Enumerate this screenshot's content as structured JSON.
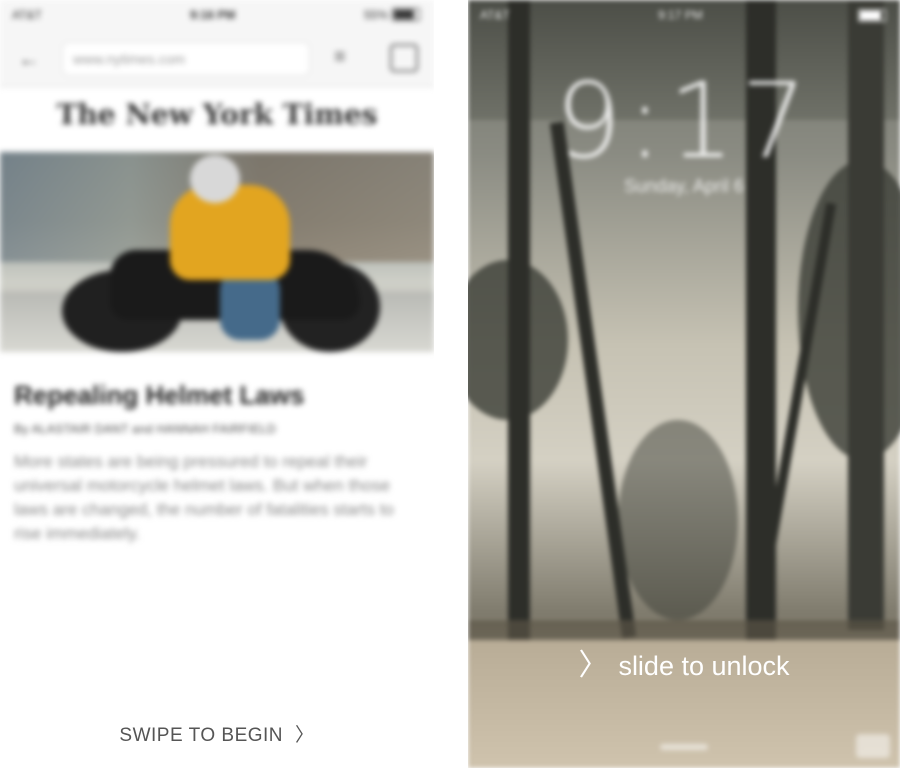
{
  "left_phone": {
    "status": {
      "carrier": "AT&T",
      "time": "9:16 PM",
      "battery": "55%"
    },
    "browser": {
      "url": "www.nytimes.com"
    },
    "masthead": "The New York Times",
    "article": {
      "headline": "Repealing Helmet Laws",
      "byline": "By ALASTAIR DANT and HANNAH FAIRFIELD",
      "summary": "More states are being pressured to repeal their universal motorcycle helmet laws. But when those laws are changed, the number of fatalities starts to rise immediately."
    },
    "swipe_label": "SWIPE TO BEGIN",
    "swipe_icon": "chevron-right-icon"
  },
  "right_phone": {
    "status": {
      "carrier": "AT&T",
      "time": "9:17 PM"
    },
    "clock": "9:17",
    "date": "Sunday, April 6",
    "slide_label": "slide to unlock",
    "slide_icon": "chevron-right-icon",
    "camera_icon": "camera-icon"
  }
}
